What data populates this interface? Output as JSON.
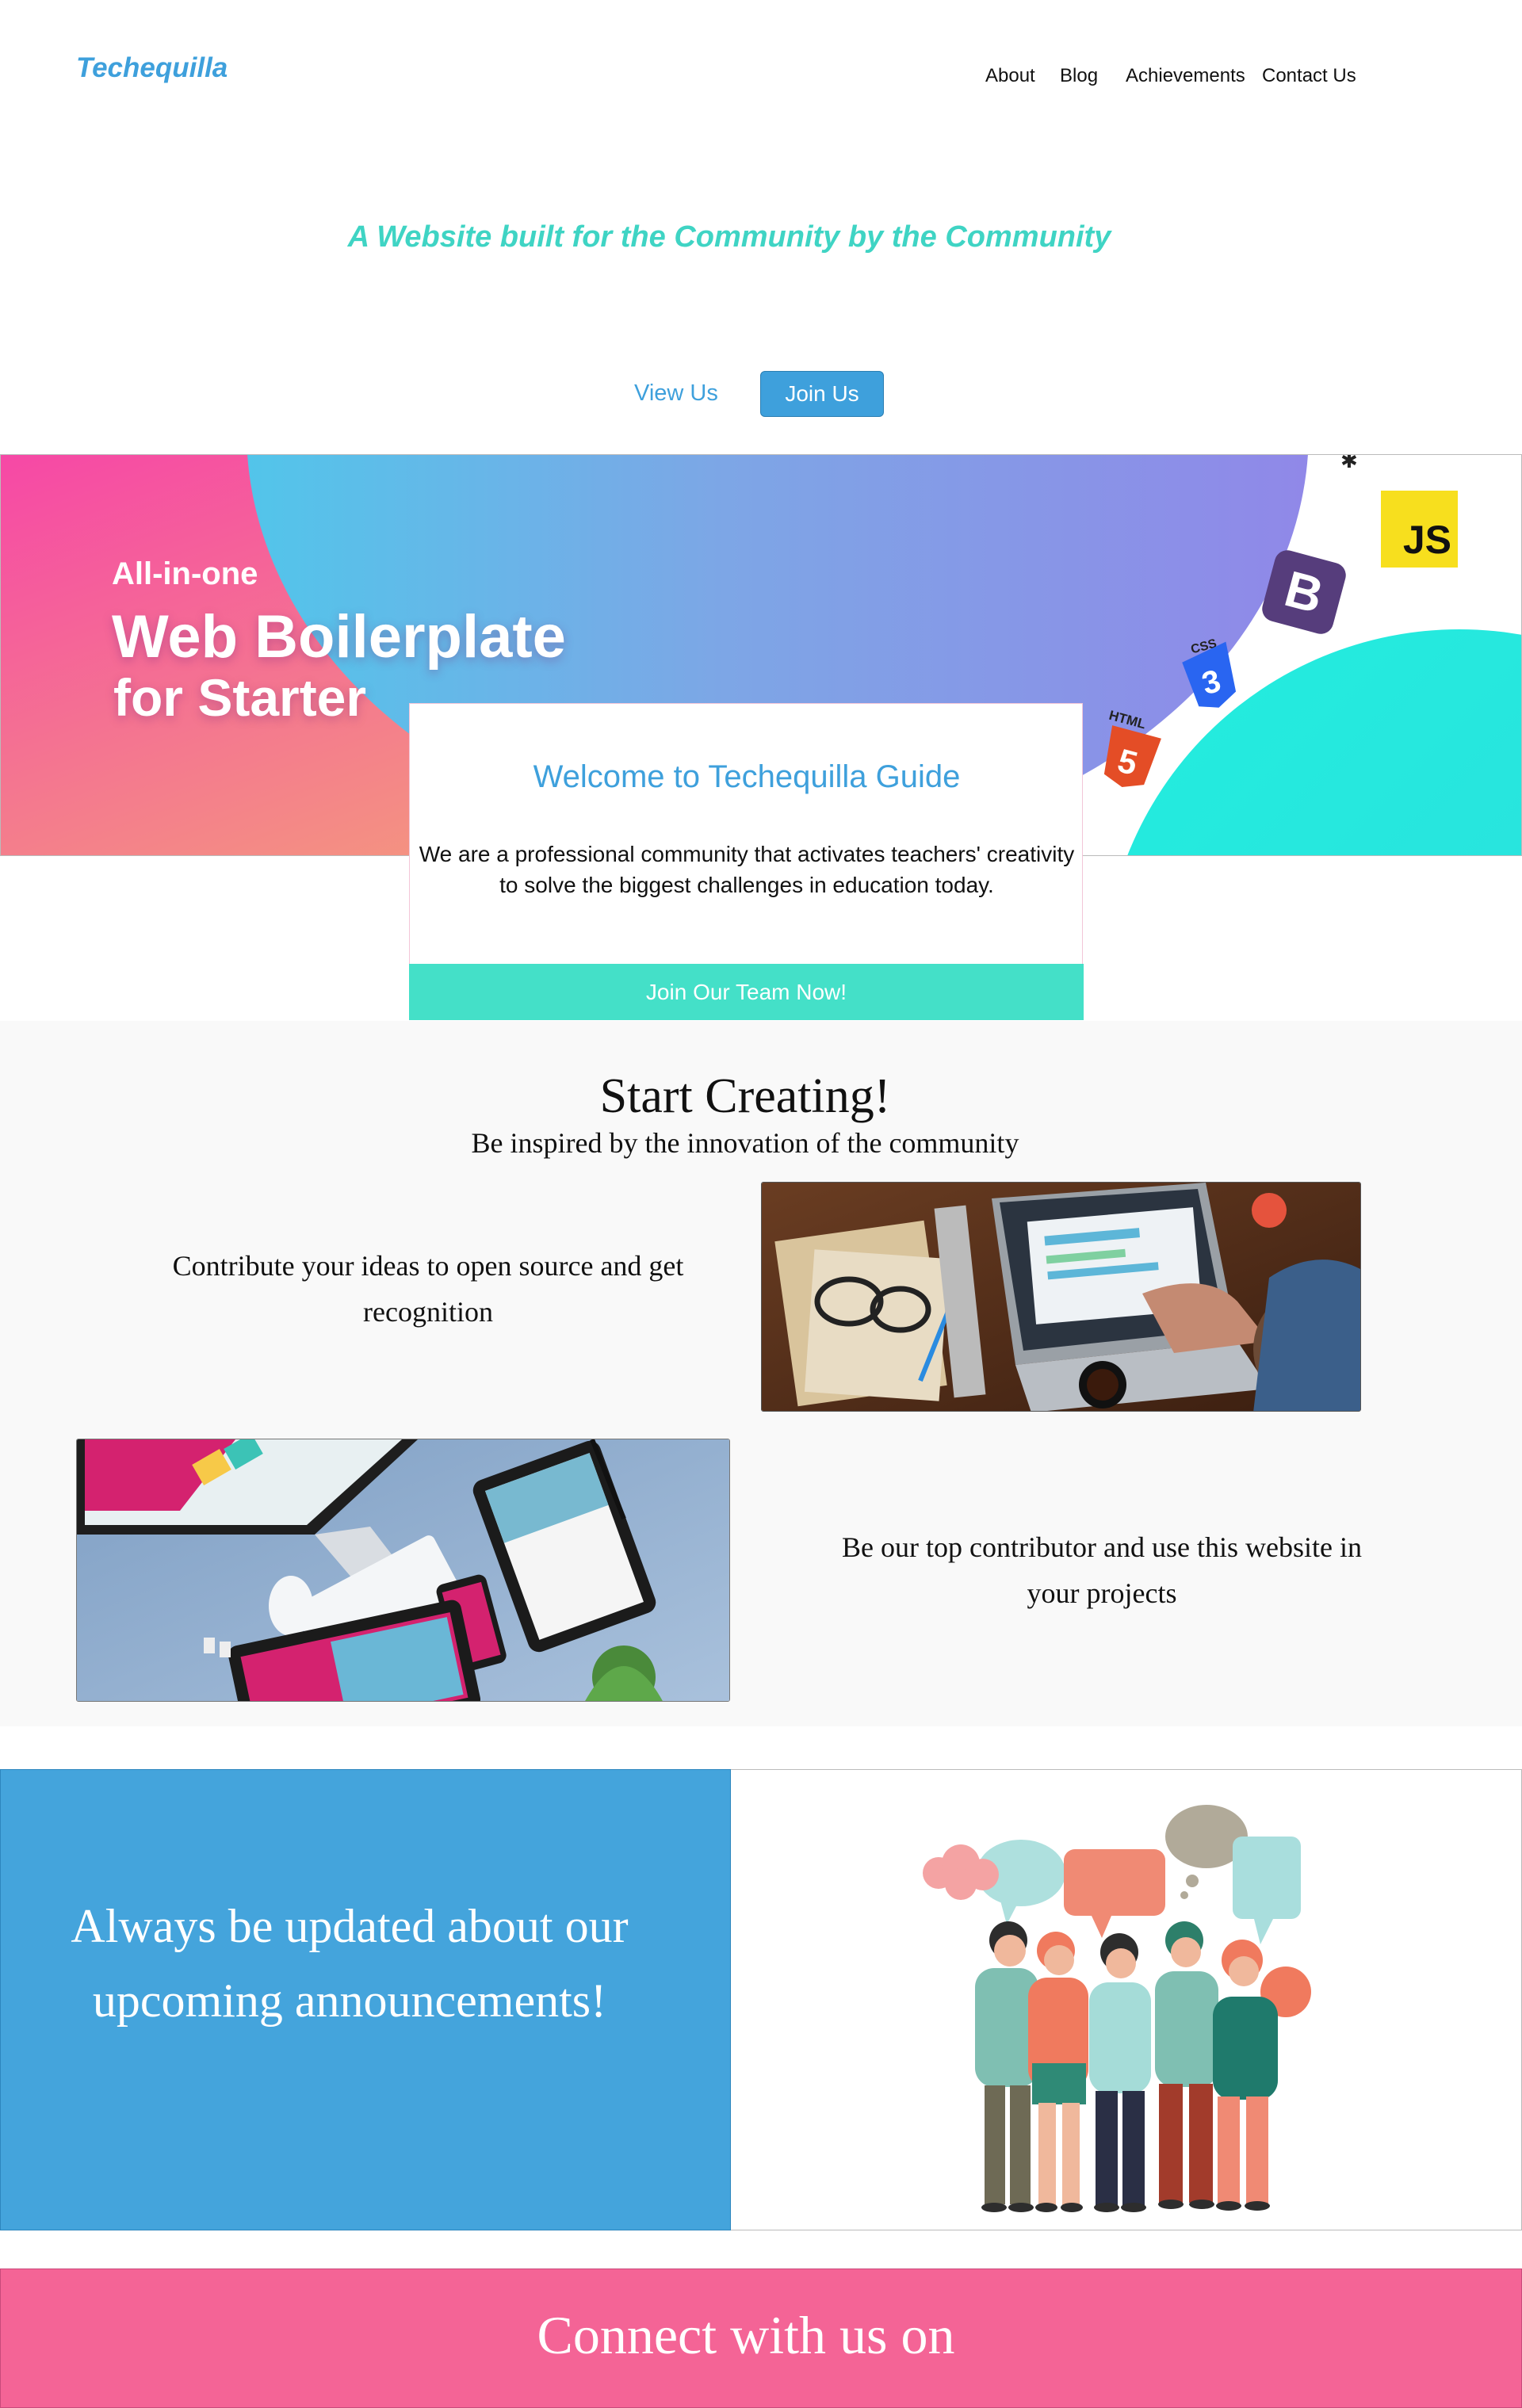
{
  "header": {
    "brand": "Techequilla",
    "nav": [
      "About",
      "Blog",
      "Achievements",
      "Contact Us"
    ]
  },
  "hero": {
    "tagline": "A Website built for the Community by the Community",
    "view_label": "View Us",
    "join_label": "Join Us"
  },
  "banner": {
    "line1": "All-in-one",
    "line2": "Web Boilerplate",
    "line3": "for Starter",
    "logos": [
      "JS",
      "B",
      "CSS",
      "HTML"
    ]
  },
  "welcome": {
    "title": "Welcome to Techequilla Guide",
    "body": "We are a professional community that activates teachers' creativity to solve the biggest challenges in education today.",
    "cta": "Join Our Team Now!"
  },
  "creating": {
    "title": "Start Creating!",
    "subtitle": "Be inspired by the innovation of the community",
    "item1": "Contribute your ideas to open source and get recognition",
    "item2": "Be our top contributor and use this website in your projects"
  },
  "announce": {
    "text": "Always be updated about our upcoming announcements!"
  },
  "connect": {
    "title": "Connect with us on"
  },
  "colors": {
    "accent": "#3ea0dc",
    "teal": "#44e0c8",
    "pink": "#f46496",
    "banner_pink": "#f648a6",
    "banner_purple": "#9088e8"
  }
}
